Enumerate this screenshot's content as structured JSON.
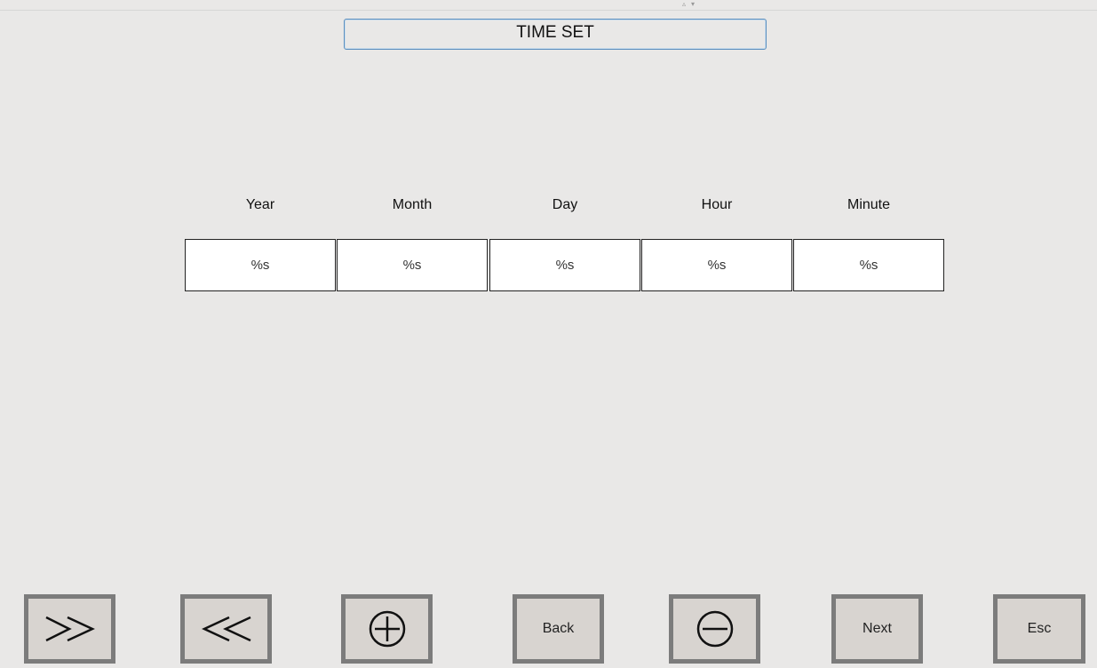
{
  "title": "TIME SET",
  "fields": [
    {
      "label": "Year",
      "value": "%s"
    },
    {
      "label": "Month",
      "value": "%s"
    },
    {
      "label": "Day",
      "value": "%s"
    },
    {
      "label": "Hour",
      "value": "%s"
    },
    {
      "label": "Minute",
      "value": "%s"
    }
  ],
  "buttons": {
    "next_field_icon": "double-chevron-right-icon",
    "prev_field_icon": "double-chevron-left-icon",
    "increment_icon": "circle-plus-icon",
    "back_label": "Back",
    "decrement_icon": "circle-minus-icon",
    "next_label": "Next",
    "esc_label": "Esc"
  }
}
